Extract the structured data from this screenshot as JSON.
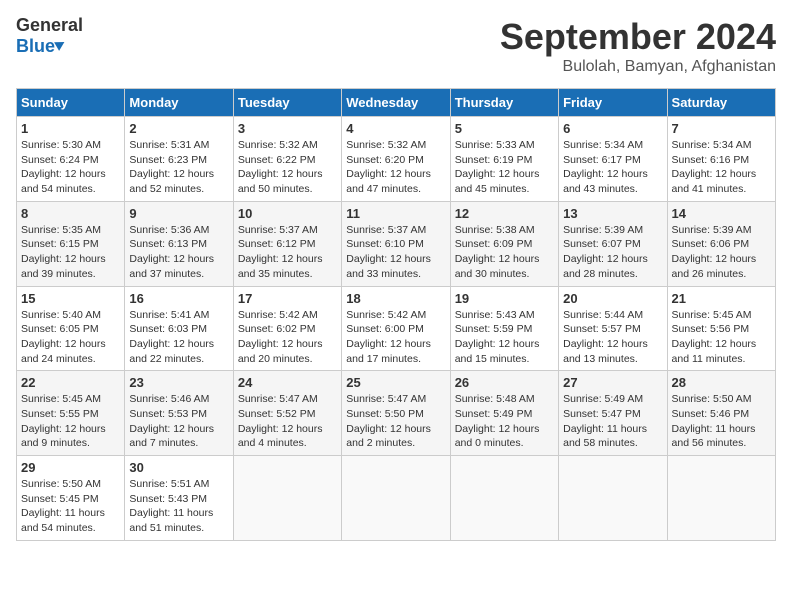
{
  "logo": {
    "general": "General",
    "blue": "Blue"
  },
  "header": {
    "month": "September 2024",
    "location": "Bulolah, Bamyan, Afghanistan"
  },
  "columns": [
    "Sunday",
    "Monday",
    "Tuesday",
    "Wednesday",
    "Thursday",
    "Friday",
    "Saturday"
  ],
  "weeks": [
    [
      {
        "day": "1",
        "sunrise": "Sunrise: 5:30 AM",
        "sunset": "Sunset: 6:24 PM",
        "daylight": "Daylight: 12 hours and 54 minutes."
      },
      {
        "day": "2",
        "sunrise": "Sunrise: 5:31 AM",
        "sunset": "Sunset: 6:23 PM",
        "daylight": "Daylight: 12 hours and 52 minutes."
      },
      {
        "day": "3",
        "sunrise": "Sunrise: 5:32 AM",
        "sunset": "Sunset: 6:22 PM",
        "daylight": "Daylight: 12 hours and 50 minutes."
      },
      {
        "day": "4",
        "sunrise": "Sunrise: 5:32 AM",
        "sunset": "Sunset: 6:20 PM",
        "daylight": "Daylight: 12 hours and 47 minutes."
      },
      {
        "day": "5",
        "sunrise": "Sunrise: 5:33 AM",
        "sunset": "Sunset: 6:19 PM",
        "daylight": "Daylight: 12 hours and 45 minutes."
      },
      {
        "day": "6",
        "sunrise": "Sunrise: 5:34 AM",
        "sunset": "Sunset: 6:17 PM",
        "daylight": "Daylight: 12 hours and 43 minutes."
      },
      {
        "day": "7",
        "sunrise": "Sunrise: 5:34 AM",
        "sunset": "Sunset: 6:16 PM",
        "daylight": "Daylight: 12 hours and 41 minutes."
      }
    ],
    [
      {
        "day": "8",
        "sunrise": "Sunrise: 5:35 AM",
        "sunset": "Sunset: 6:15 PM",
        "daylight": "Daylight: 12 hours and 39 minutes."
      },
      {
        "day": "9",
        "sunrise": "Sunrise: 5:36 AM",
        "sunset": "Sunset: 6:13 PM",
        "daylight": "Daylight: 12 hours and 37 minutes."
      },
      {
        "day": "10",
        "sunrise": "Sunrise: 5:37 AM",
        "sunset": "Sunset: 6:12 PM",
        "daylight": "Daylight: 12 hours and 35 minutes."
      },
      {
        "day": "11",
        "sunrise": "Sunrise: 5:37 AM",
        "sunset": "Sunset: 6:10 PM",
        "daylight": "Daylight: 12 hours and 33 minutes."
      },
      {
        "day": "12",
        "sunrise": "Sunrise: 5:38 AM",
        "sunset": "Sunset: 6:09 PM",
        "daylight": "Daylight: 12 hours and 30 minutes."
      },
      {
        "day": "13",
        "sunrise": "Sunrise: 5:39 AM",
        "sunset": "Sunset: 6:07 PM",
        "daylight": "Daylight: 12 hours and 28 minutes."
      },
      {
        "day": "14",
        "sunrise": "Sunrise: 5:39 AM",
        "sunset": "Sunset: 6:06 PM",
        "daylight": "Daylight: 12 hours and 26 minutes."
      }
    ],
    [
      {
        "day": "15",
        "sunrise": "Sunrise: 5:40 AM",
        "sunset": "Sunset: 6:05 PM",
        "daylight": "Daylight: 12 hours and 24 minutes."
      },
      {
        "day": "16",
        "sunrise": "Sunrise: 5:41 AM",
        "sunset": "Sunset: 6:03 PM",
        "daylight": "Daylight: 12 hours and 22 minutes."
      },
      {
        "day": "17",
        "sunrise": "Sunrise: 5:42 AM",
        "sunset": "Sunset: 6:02 PM",
        "daylight": "Daylight: 12 hours and 20 minutes."
      },
      {
        "day": "18",
        "sunrise": "Sunrise: 5:42 AM",
        "sunset": "Sunset: 6:00 PM",
        "daylight": "Daylight: 12 hours and 17 minutes."
      },
      {
        "day": "19",
        "sunrise": "Sunrise: 5:43 AM",
        "sunset": "Sunset: 5:59 PM",
        "daylight": "Daylight: 12 hours and 15 minutes."
      },
      {
        "day": "20",
        "sunrise": "Sunrise: 5:44 AM",
        "sunset": "Sunset: 5:57 PM",
        "daylight": "Daylight: 12 hours and 13 minutes."
      },
      {
        "day": "21",
        "sunrise": "Sunrise: 5:45 AM",
        "sunset": "Sunset: 5:56 PM",
        "daylight": "Daylight: 12 hours and 11 minutes."
      }
    ],
    [
      {
        "day": "22",
        "sunrise": "Sunrise: 5:45 AM",
        "sunset": "Sunset: 5:55 PM",
        "daylight": "Daylight: 12 hours and 9 minutes."
      },
      {
        "day": "23",
        "sunrise": "Sunrise: 5:46 AM",
        "sunset": "Sunset: 5:53 PM",
        "daylight": "Daylight: 12 hours and 7 minutes."
      },
      {
        "day": "24",
        "sunrise": "Sunrise: 5:47 AM",
        "sunset": "Sunset: 5:52 PM",
        "daylight": "Daylight: 12 hours and 4 minutes."
      },
      {
        "day": "25",
        "sunrise": "Sunrise: 5:47 AM",
        "sunset": "Sunset: 5:50 PM",
        "daylight": "Daylight: 12 hours and 2 minutes."
      },
      {
        "day": "26",
        "sunrise": "Sunrise: 5:48 AM",
        "sunset": "Sunset: 5:49 PM",
        "daylight": "Daylight: 12 hours and 0 minutes."
      },
      {
        "day": "27",
        "sunrise": "Sunrise: 5:49 AM",
        "sunset": "Sunset: 5:47 PM",
        "daylight": "Daylight: 11 hours and 58 minutes."
      },
      {
        "day": "28",
        "sunrise": "Sunrise: 5:50 AM",
        "sunset": "Sunset: 5:46 PM",
        "daylight": "Daylight: 11 hours and 56 minutes."
      }
    ],
    [
      {
        "day": "29",
        "sunrise": "Sunrise: 5:50 AM",
        "sunset": "Sunset: 5:45 PM",
        "daylight": "Daylight: 11 hours and 54 minutes."
      },
      {
        "day": "30",
        "sunrise": "Sunrise: 5:51 AM",
        "sunset": "Sunset: 5:43 PM",
        "daylight": "Daylight: 11 hours and 51 minutes."
      },
      null,
      null,
      null,
      null,
      null
    ]
  ]
}
